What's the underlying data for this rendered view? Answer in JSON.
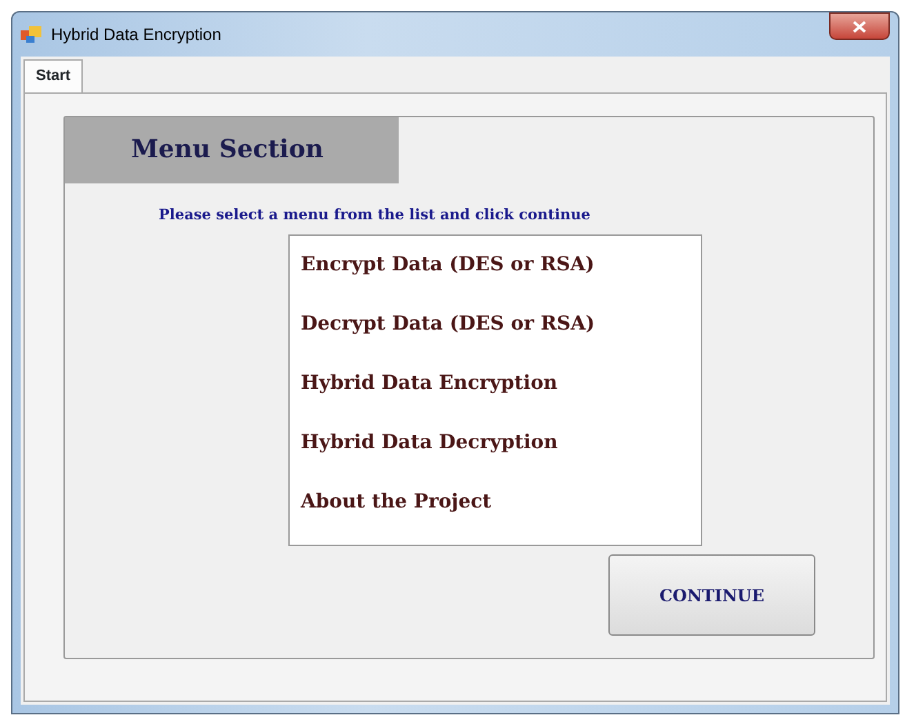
{
  "window": {
    "title": "Hybrid Data Encryption"
  },
  "tabs": [
    {
      "label": "Start",
      "selected": true
    }
  ],
  "section": {
    "title": "Menu Section",
    "prompt": "Please select a menu from the list and click continue"
  },
  "menu_list": [
    {
      "label": "Encrypt Data (DES or RSA)",
      "selected": false
    },
    {
      "label": "Decrypt Data (DES or RSA)",
      "selected": false
    },
    {
      "label": "Hybrid Data Encryption",
      "selected": false
    },
    {
      "label": "Hybrid Data Decryption",
      "selected": false
    },
    {
      "label": "About the Project",
      "selected": false
    }
  ],
  "buttons": [
    "CONTINUE"
  ]
}
